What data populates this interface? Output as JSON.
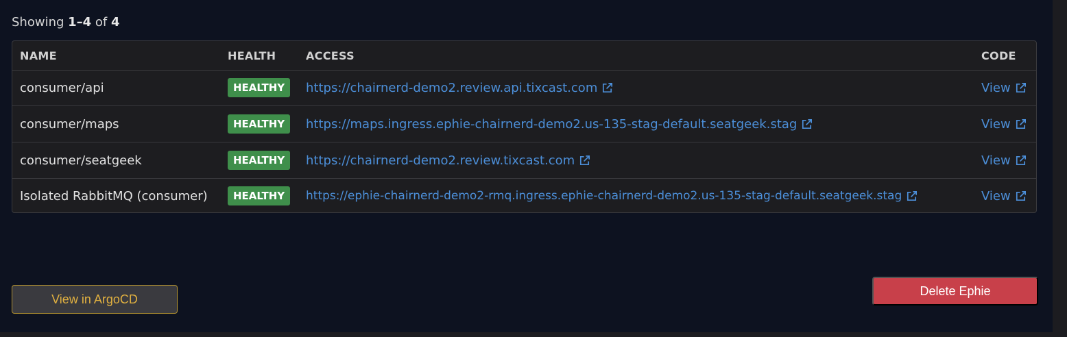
{
  "summary": {
    "prefix": "Showing ",
    "range": "1–4",
    "of": " of ",
    "total": "4"
  },
  "table": {
    "headers": {
      "name": "NAME",
      "health": "HEALTH",
      "access": "ACCESS",
      "code": "CODE"
    },
    "rows": [
      {
        "name": "consumer/api",
        "health": "HEALTHY",
        "access": "https://chairnerd-demo2.review.api.tixcast.com",
        "code": "View"
      },
      {
        "name": "consumer/maps",
        "health": "HEALTHY",
        "access": "https://maps.ingress.ephie-chairnerd-demo2.us-135-stag-default.seatgeek.stag",
        "code": "View"
      },
      {
        "name": "consumer/seatgeek",
        "health": "HEALTHY",
        "access": "https://chairnerd-demo2.review.tixcast.com",
        "code": "View"
      },
      {
        "name": "Isolated RabbitMQ (consumer)",
        "health": "HEALTHY",
        "access": "https://ephie-chairnerd-demo2-rmq.ingress.ephie-chairnerd-demo2.us-135-stag-default.seatgeek.stag",
        "code": "View"
      }
    ]
  },
  "actions": {
    "argocd_label": "View in ArgoCD",
    "delete_label": "Delete Ephie"
  },
  "colors": {
    "healthy": "#3f8f4b",
    "link": "#4c8fd9",
    "danger": "#c8404a",
    "argo_accent": "#e0b040"
  },
  "icons": {
    "external": "external-link-icon"
  }
}
